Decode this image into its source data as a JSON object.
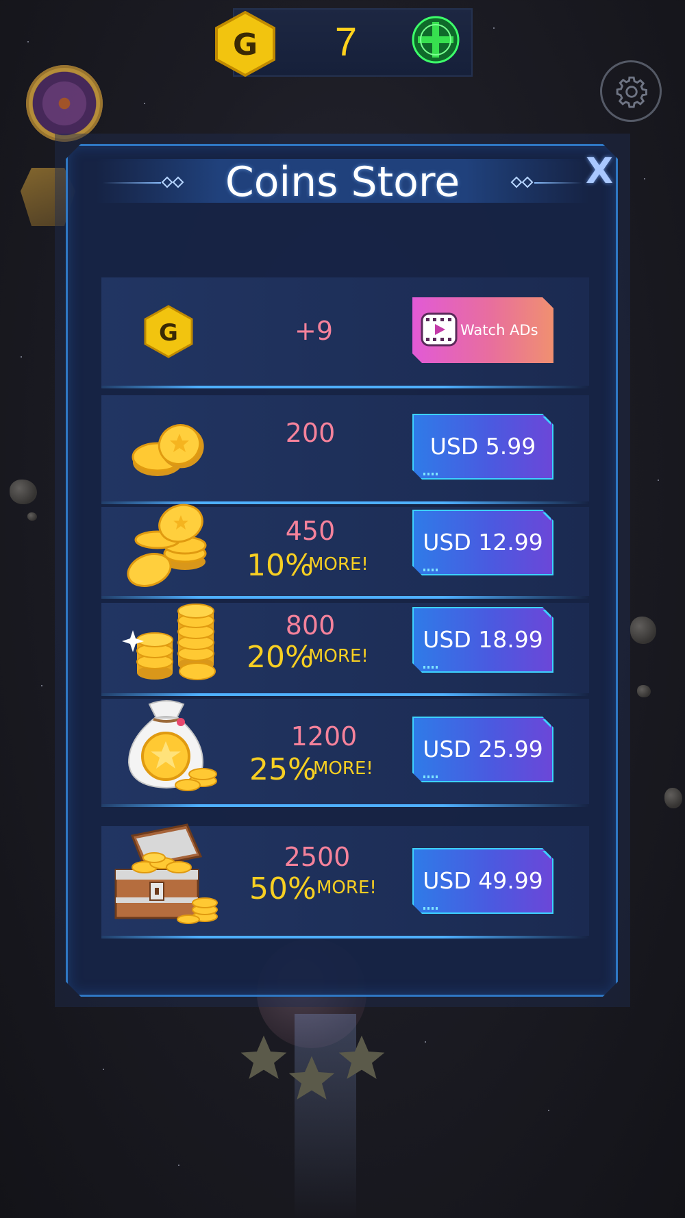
{
  "hud": {
    "currency_icon": "g-hexagon-icon",
    "currency_count": "7",
    "add_icon": "add-coins-plus-icon"
  },
  "store": {
    "title": "Coins Store",
    "close_label": "X",
    "ad_offer": {
      "icon": "g-hexagon-icon",
      "amount": "+9",
      "button_label": "Watch ADs",
      "button_icon": "video-play-icon"
    },
    "packs": [
      {
        "icon": "coin-pair-icon",
        "amount": "200",
        "bonus_pct": "",
        "bonus_more": "",
        "price": "USD 5.99"
      },
      {
        "icon": "coin-pile-icon",
        "amount": "450",
        "bonus_pct": "10%",
        "bonus_more": "MORE!",
        "price": "USD 12.99"
      },
      {
        "icon": "coin-stacks-icon",
        "amount": "800",
        "bonus_pct": "20%",
        "bonus_more": "MORE!",
        "price": "USD 18.99"
      },
      {
        "icon": "coin-bag-icon",
        "amount": "1200",
        "bonus_pct": "25%",
        "bonus_more": "MORE!",
        "price": "USD 25.99"
      },
      {
        "icon": "treasure-chest-icon",
        "amount": "2500",
        "bonus_pct": "50%",
        "bonus_more": "MORE!",
        "price": "USD 49.99"
      }
    ]
  },
  "colors": {
    "accent_gold": "#f7cf22",
    "amount_pink": "#f5829b",
    "price_button": "#4a5ae0",
    "ad_button": "#e86e9e",
    "frame_blue": "#2f78c4"
  }
}
